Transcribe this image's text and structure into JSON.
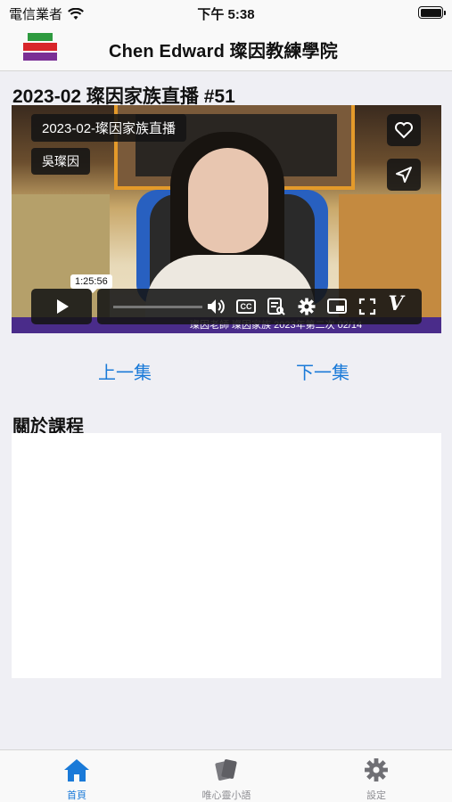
{
  "status_bar": {
    "carrier": "電信業者",
    "time": "下午 5:38"
  },
  "nav": {
    "title": "Chen Edward  璨因教練學院"
  },
  "episode": {
    "title": "2023-02 璨因家族直播 #51",
    "video_title": "2023-02-璨因家族直播",
    "video_author": "吳璨因",
    "hover_time": "1:25:56",
    "banner_text": "璨因老師 璨因家族 2023年第二次 02/14"
  },
  "episode_nav": {
    "prev": "上一集",
    "next": "下一集"
  },
  "about": {
    "heading": "關於課程"
  },
  "video_icons": [
    "heart-icon",
    "send-icon",
    "play-icon",
    "volume-icon",
    "cc-icon",
    "transcript-icon",
    "gear-icon",
    "pip-icon",
    "fullscreen-icon",
    "vimeo-logo"
  ],
  "tabs": [
    {
      "label": "首頁",
      "icon": "home-icon",
      "active": true
    },
    {
      "label": "唯心靈小語",
      "icon": "cards-icon",
      "active": false
    },
    {
      "label": "設定",
      "icon": "gear-icon",
      "active": false
    }
  ],
  "colors": {
    "accent": "#1a7ad8",
    "inactive": "#8e8e93"
  }
}
